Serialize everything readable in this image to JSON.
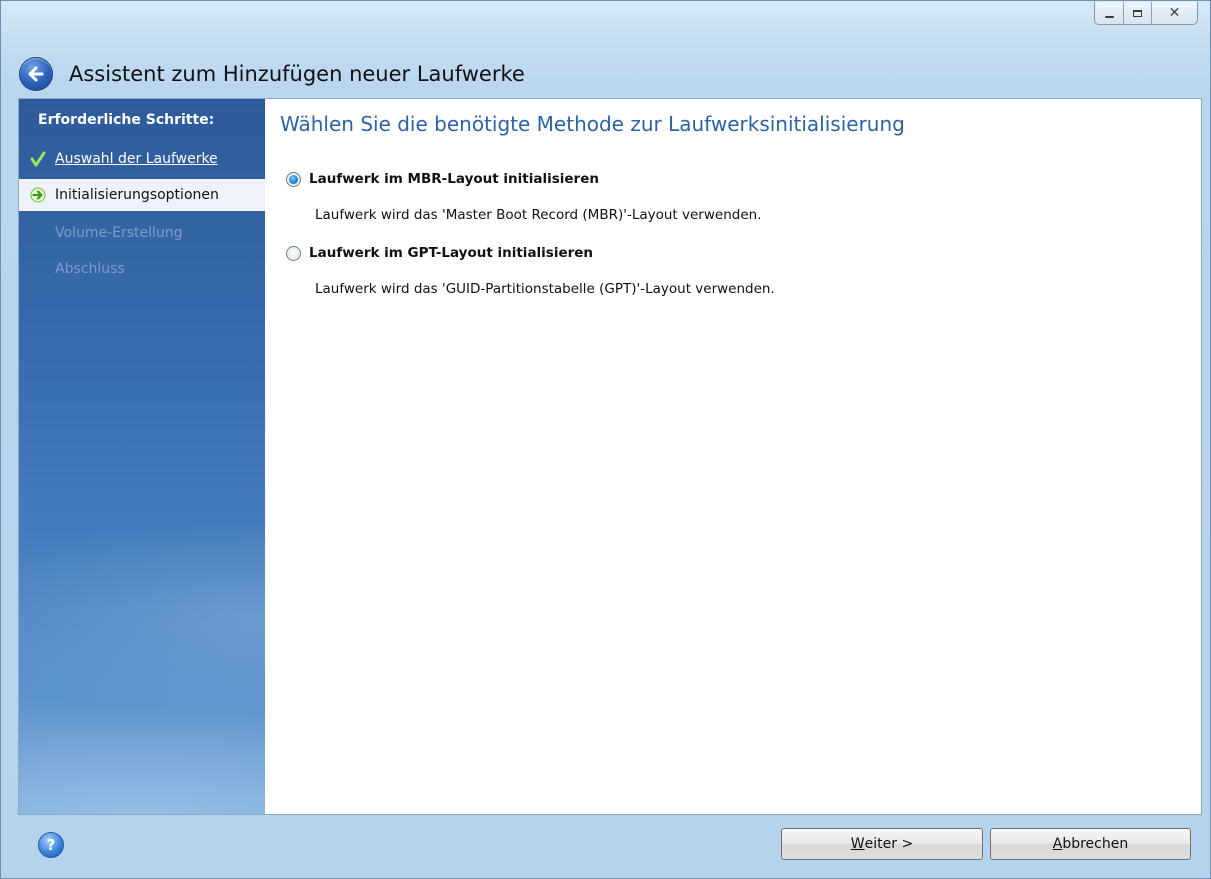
{
  "window": {
    "title": "Assistent zum Hinzufügen neuer Laufwerke"
  },
  "sidebar": {
    "heading": "Erforderliche Schritte:",
    "steps": [
      {
        "label": "Auswahl der Laufwerke",
        "state": "completed",
        "icon": "checkmark-icon"
      },
      {
        "label": "Initialisierungsoptionen",
        "state": "current",
        "icon": "arrow-right-icon"
      },
      {
        "label": "Volume-Erstellung",
        "state": "disabled"
      },
      {
        "label": "Abschluss",
        "state": "disabled"
      }
    ]
  },
  "main": {
    "heading": "Wählen Sie die benötigte Methode zur Laufwerksinitialisierung",
    "options": [
      {
        "label": "Laufwerk im MBR-Layout initialisieren",
        "description": "Laufwerk wird das 'Master Boot Record (MBR)'-Layout verwenden.",
        "selected": true
      },
      {
        "label": "Laufwerk im GPT-Layout initialisieren",
        "description": "Laufwerk wird das 'GUID-Partitionstabelle (GPT)'-Layout verwenden.",
        "selected": false
      }
    ]
  },
  "footer": {
    "help_icon": "help-icon",
    "next_mnemonic": "W",
    "next_rest": "eiter >",
    "cancel_mnemonic": "A",
    "cancel_rest": "bbrechen"
  },
  "colors": {
    "accent_heading": "#2b63a8",
    "sidebar_top": "#2d5a9a",
    "sidebar_bottom": "#7aaad8",
    "disabled_step": "#7c9ccb"
  }
}
